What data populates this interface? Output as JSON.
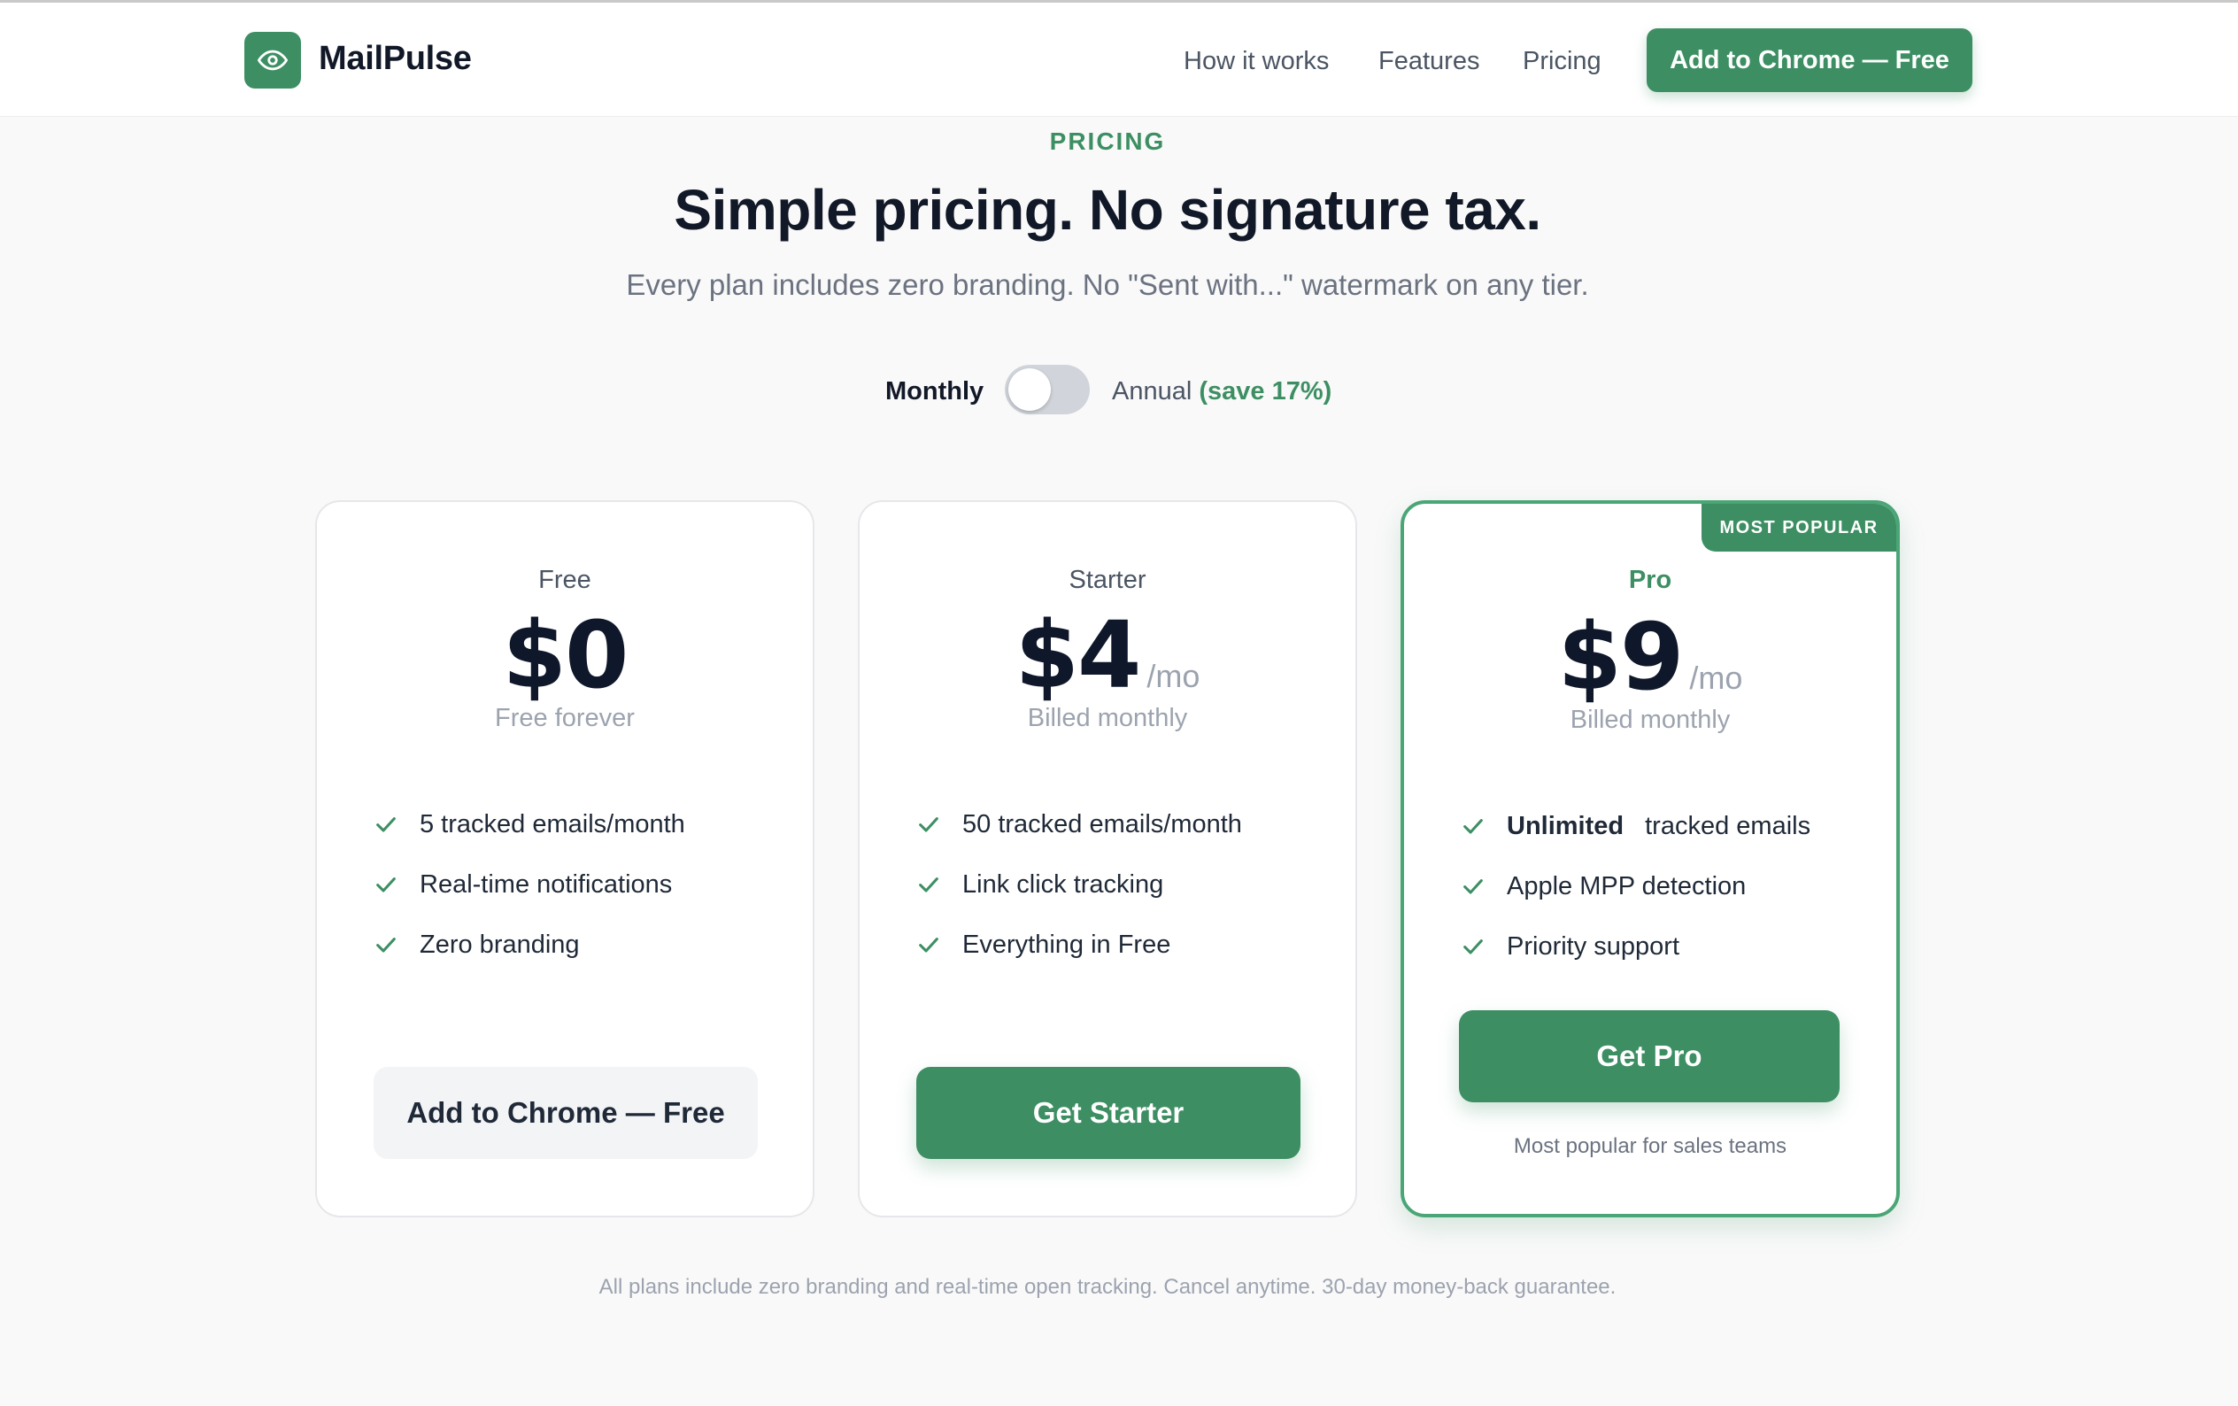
{
  "brand": {
    "name": "MailPulse",
    "logo_icon": "eye-icon"
  },
  "nav": {
    "links": [
      "How it works",
      "Features",
      "Pricing"
    ],
    "cta_label": "Add to Chrome — Free"
  },
  "hero": {
    "eyebrow": "PRICING",
    "title": "Simple pricing. No signature tax.",
    "subtitle": "Every plan includes zero branding. No \"Sent with...\" watermark on any tier."
  },
  "billing_toggle": {
    "monthly_label": "Monthly",
    "annual_label": "Annual",
    "save_label": "(save 17%)",
    "annual_selected": false
  },
  "plans": [
    {
      "name": "Free",
      "price": "$0",
      "per": "",
      "note": "Free forever",
      "features": [
        {
          "strong": "",
          "text": "5 tracked emails/month"
        },
        {
          "strong": "",
          "text": "Real-time notifications"
        },
        {
          "strong": "",
          "text": "Zero branding"
        }
      ],
      "cta": "Add to Chrome — Free"
    },
    {
      "name": "Starter",
      "price": "$4",
      "per": "/mo",
      "note": "Billed monthly",
      "features": [
        {
          "strong": "",
          "text": "50 tracked emails/month"
        },
        {
          "strong": "",
          "text": "Link click tracking"
        },
        {
          "strong": "",
          "text": "Everything in Free"
        }
      ],
      "cta": "Get Starter"
    },
    {
      "name": "Pro",
      "badge": "MOST POPULAR",
      "price": "$9",
      "per": "/mo",
      "note": "Billed monthly",
      "features": [
        {
          "strong": "Unlimited",
          "text": "tracked emails"
        },
        {
          "strong": "",
          "text": "Apple MPP detection"
        },
        {
          "strong": "",
          "text": "Priority support"
        }
      ],
      "cta": "Get Pro",
      "cta_note": "Most popular for sales teams"
    }
  ],
  "footnote": "All plans include zero branding and real-time open tracking. Cancel anytime. 30-day money-back guarantee.",
  "colors": {
    "accent": "#3d8f63",
    "accent_border": "#4aa676",
    "text": "#111827",
    "muted": "#9ca3af"
  }
}
